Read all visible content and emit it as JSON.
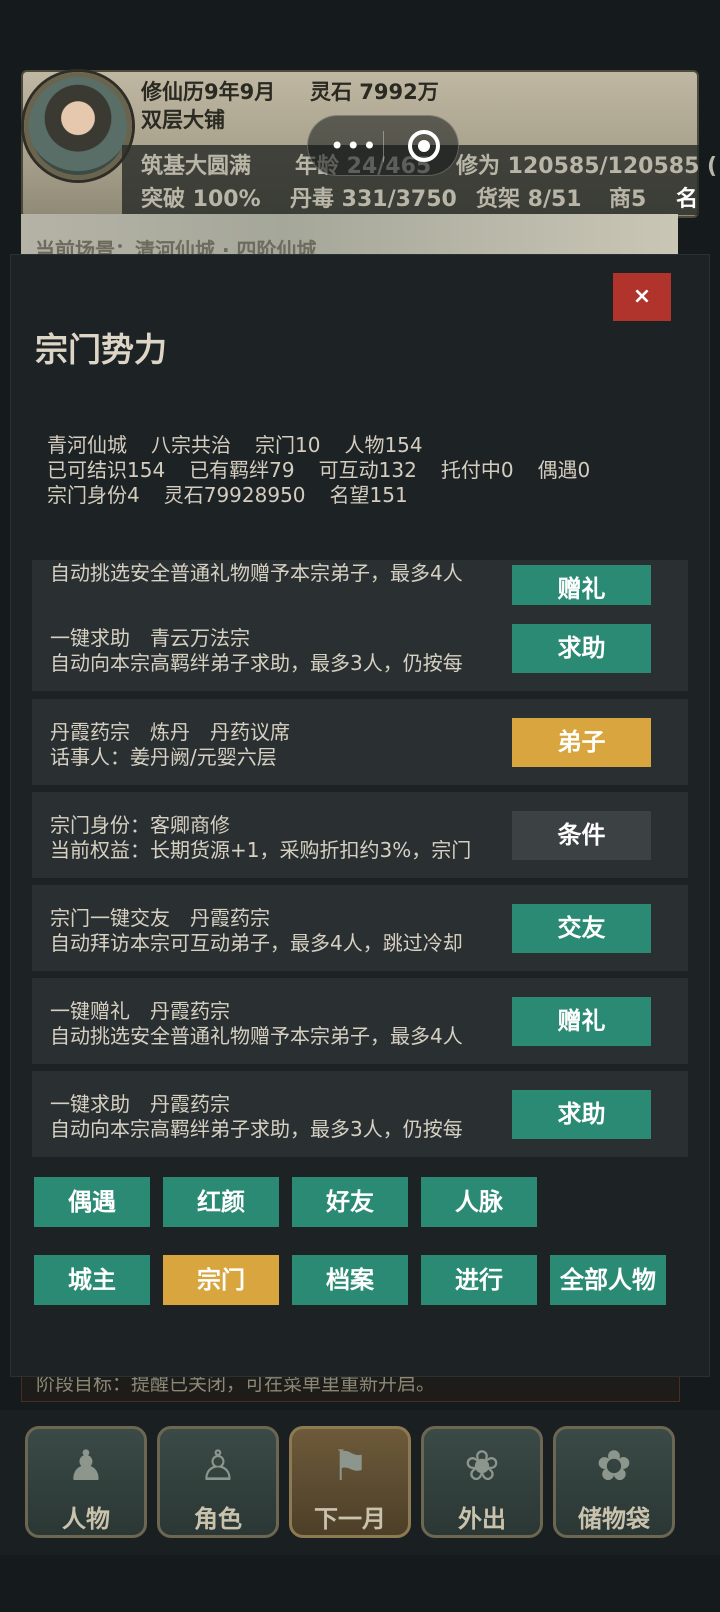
{
  "hud": {
    "date": "修仙历9年9月",
    "spirit_stones": "灵石 7992万",
    "shop": "双层大铺",
    "realm": "筑基大圆满",
    "age": "年龄 24/465",
    "cultivation": "修为 120585/120585 (",
    "breakthrough": "突破 100%",
    "pill_poison": "丹毒 331/3750",
    "shelves": "货架 8/51",
    "merchant": "商5",
    "cut_text": "名",
    "scene": "当前场景：清河仙城 · 四阶仙城"
  },
  "modal": {
    "close_label": "×",
    "title": "宗门势力",
    "info": {
      "line1": [
        "青河仙城",
        "八宗共治",
        "宗门10",
        "人物154"
      ],
      "line2": [
        "已可结识154",
        "已有羁绊79",
        "可互动132",
        "托付中0",
        "偶遇0"
      ],
      "line3": [
        "宗门身份4",
        "灵石79928950",
        "名望151"
      ]
    },
    "cards": [
      {
        "line1": "自动挑选安全普通礼物赠予本宗弟子，最多4人",
        "line2": "",
        "action": "赠礼",
        "color": "teal"
      },
      {
        "line1": "一键求助　青云万法宗",
        "line2": "自动向本宗高羁绊弟子求助，最多3人，仍按每",
        "action": "求助",
        "color": "teal"
      },
      {
        "line1": "丹霞药宗　炼丹　丹药议席",
        "line2": "话事人：姜丹阙/元婴六层",
        "action": "弟子",
        "color": "gold"
      },
      {
        "line1": "宗门身份：客卿商修",
        "line2": "当前权益：长期货源+1，采购折扣约3%，宗门",
        "action": "条件",
        "color": "grey"
      },
      {
        "line1": "宗门一键交友　丹霞药宗",
        "line2": "自动拜访本宗可互动弟子，最多4人，跳过冷却",
        "action": "交友",
        "color": "teal"
      },
      {
        "line1": "一键赠礼　丹霞药宗",
        "line2": "自动挑选安全普通礼物赠予本宗弟子，最多4人",
        "action": "赠礼",
        "color": "teal"
      },
      {
        "line1": "一键求助　丹霞药宗",
        "line2": "自动向本宗高羁绊弟子求助，最多3人，仍按每",
        "action": "求助",
        "color": "teal"
      }
    ],
    "tabs_row1": [
      {
        "label": "偶遇",
        "color": "teal"
      },
      {
        "label": "红颜",
        "color": "teal"
      },
      {
        "label": "好友",
        "color": "teal"
      },
      {
        "label": "人脉",
        "color": "teal"
      }
    ],
    "tabs_row2": [
      {
        "label": "城主",
        "color": "teal"
      },
      {
        "label": "宗门",
        "color": "gold"
      },
      {
        "label": "档案",
        "color": "teal"
      },
      {
        "label": "进行",
        "color": "teal"
      },
      {
        "label": "全部人物",
        "color": "teal"
      }
    ]
  },
  "goal_text": "阶段目标：提醒已关闭，可在菜单里重新开启。",
  "nav": [
    {
      "label": "人物",
      "icon": "person-icon",
      "glyph": "♟",
      "active": false
    },
    {
      "label": "角色",
      "icon": "robe-icon",
      "glyph": "♙",
      "active": false
    },
    {
      "label": "下一月",
      "icon": "flag-icon",
      "glyph": "⚑",
      "active": true
    },
    {
      "label": "外出",
      "icon": "lotus-icon",
      "glyph": "❀",
      "active": false
    },
    {
      "label": "储物袋",
      "icon": "bag-icon",
      "glyph": "✿",
      "active": false
    }
  ],
  "colors": {
    "teal": "#2b8a74",
    "gold": "#d9a53f",
    "grey": "#3c4143",
    "close": "#b0342b"
  }
}
